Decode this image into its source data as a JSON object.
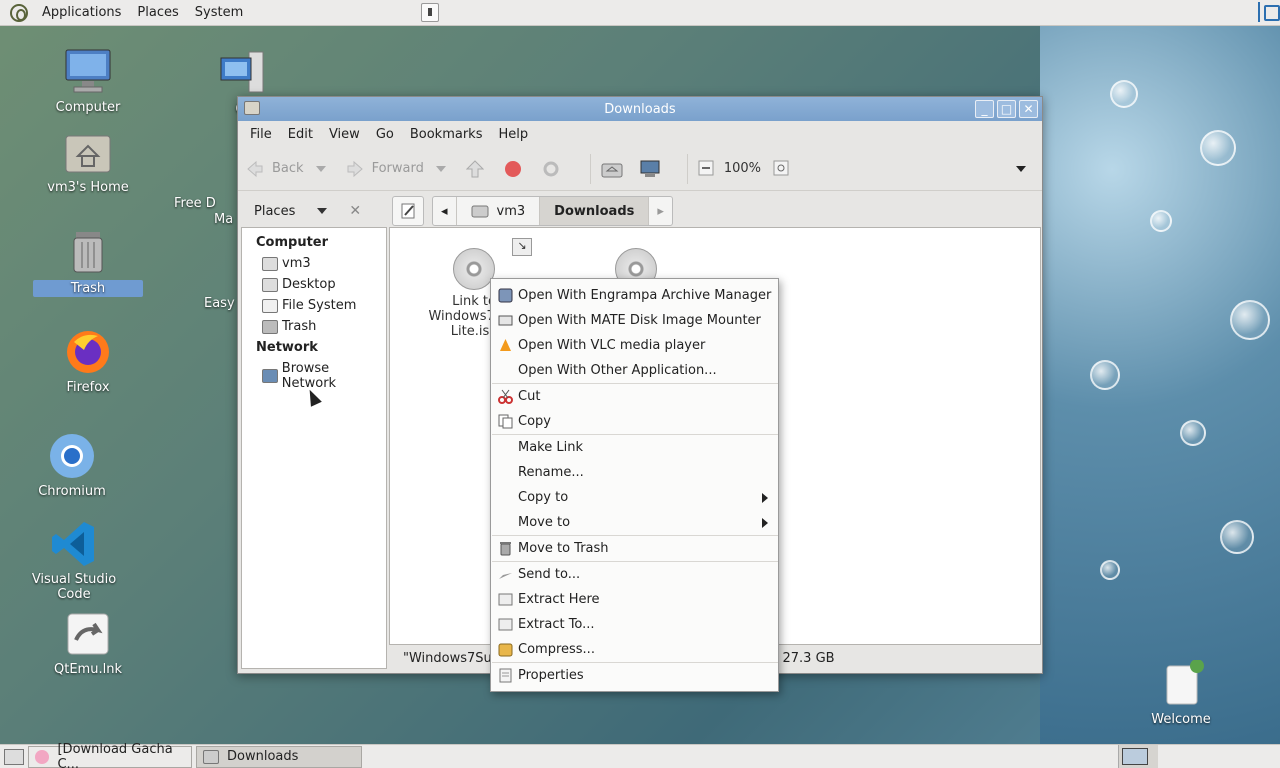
{
  "top_panel": {
    "applications": "Applications",
    "places": "Places",
    "system": "System"
  },
  "desktop": {
    "icons": [
      {
        "label": "Computer"
      },
      {
        "label": "vm3's Home"
      },
      {
        "label": "Trash"
      },
      {
        "label": "Firefox"
      },
      {
        "label": "Chromium"
      },
      {
        "label": "Visual Studio Code"
      },
      {
        "label": "QtEmu.lnk"
      },
      {
        "label": "Qt"
      },
      {
        "label": "Free D"
      },
      {
        "label": "Ma"
      },
      {
        "label": "Easy"
      },
      {
        "label": "Welcome"
      }
    ]
  },
  "window": {
    "title": "Downloads",
    "menu": [
      "File",
      "Edit",
      "View",
      "Go",
      "Bookmarks",
      "Help"
    ],
    "toolbar": {
      "back": "Back",
      "forward": "Forward",
      "zoom": "100%"
    },
    "places_header": "Places",
    "breadcrumbs": [
      "vm3",
      "Downloads"
    ],
    "sidebar": {
      "computer_header": "Computer",
      "computer_items": [
        "vm3",
        "Desktop",
        "File System",
        "Trash"
      ],
      "network_header": "Network",
      "network_items": [
        "Browse Network"
      ]
    },
    "files": [
      {
        "label_line1": "Link to",
        "label_line2": "Windows7Sup",
        "label_line3": "Lite.iso"
      }
    ],
    "status_left": "\"Windows7Sup",
    "status_right": ": 27.3 GB"
  },
  "context_menu": {
    "items": [
      {
        "label": "Open With Engrampa Archive Manager"
      },
      {
        "label": "Open With MATE Disk Image Mounter"
      },
      {
        "label": "Open With VLC media player"
      },
      {
        "label": "Open With Other Application..."
      },
      {
        "label": "Cut"
      },
      {
        "label": "Copy"
      },
      {
        "label": "Make Link"
      },
      {
        "label": "Rename..."
      },
      {
        "label": "Copy to"
      },
      {
        "label": "Move to"
      },
      {
        "label": "Move to Trash"
      },
      {
        "label": "Send to..."
      },
      {
        "label": "Extract Here"
      },
      {
        "label": "Extract To..."
      },
      {
        "label": "Compress..."
      },
      {
        "label": "Properties"
      }
    ]
  },
  "taskbar": {
    "tasks": [
      "[Download Gacha C...",
      "Downloads"
    ]
  }
}
